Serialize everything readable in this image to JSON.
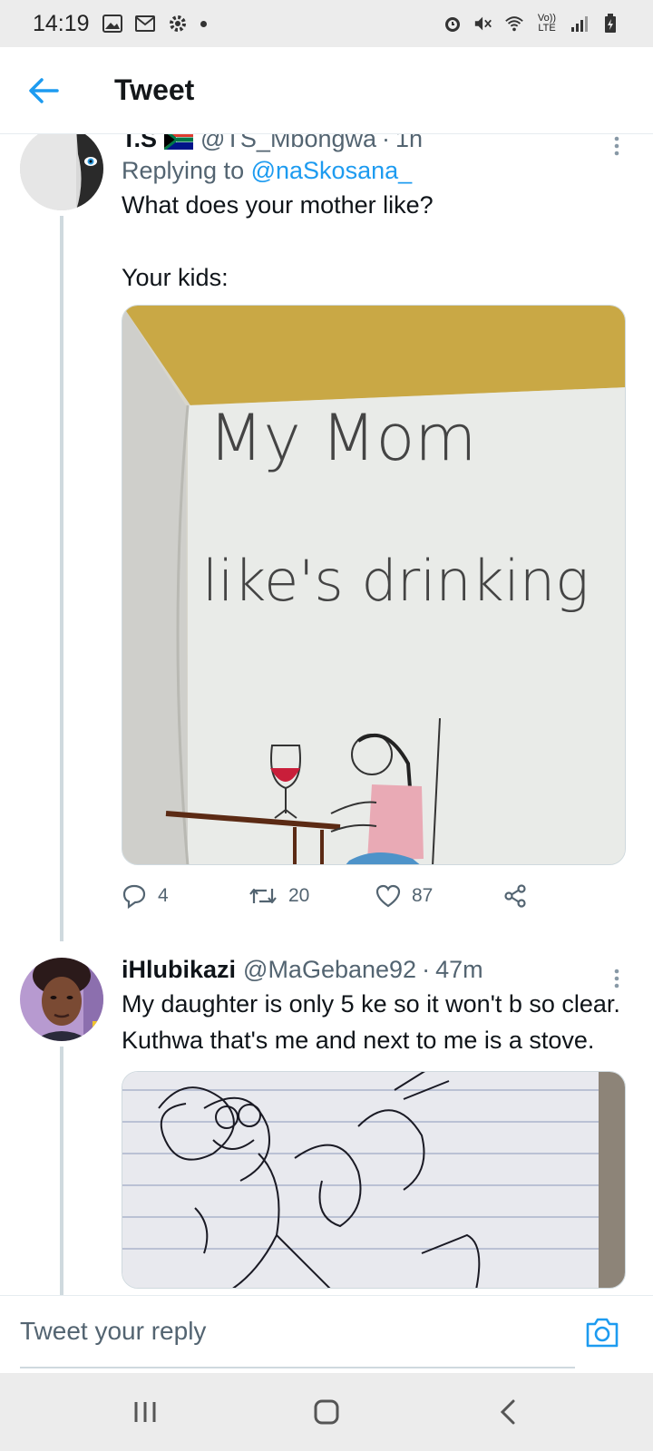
{
  "status_bar": {
    "time": "14:19",
    "left_icons": [
      "gallery-icon",
      "gmail-icon",
      "settings-icon",
      "dot"
    ],
    "right_icons": [
      "alarm-icon",
      "mute-icon",
      "wifi-icon",
      "volte-icon",
      "signal-icon",
      "battery-icon"
    ],
    "volte_label": "Vo)) LTE"
  },
  "header": {
    "title": "Tweet",
    "accent": "#1d9bf0"
  },
  "tweets": [
    {
      "name": "T.S",
      "flag": "south-africa-flag-icon",
      "handle": "@TS_Mbongwa",
      "time": "1h",
      "replying_label": "Replying to",
      "replying_to": "@naSkosana_",
      "text": "What does your mother like?\n\nYour kids:",
      "media_text_line1": "My Mom",
      "media_text_line2": "like's drinking",
      "replies": "4",
      "retweets": "20",
      "likes": "87"
    },
    {
      "name": "iHlubikazi",
      "handle": "@MaGebane92",
      "time": "47m",
      "text": "My daughter is only 5 ke so it won't b so clear. Kuthwa that's me and next to me is a stove."
    }
  ],
  "reply_bar": {
    "placeholder": "Tweet your reply"
  },
  "nav_bar": {
    "icons": [
      "recent-apps-icon",
      "home-icon",
      "back-icon"
    ]
  }
}
